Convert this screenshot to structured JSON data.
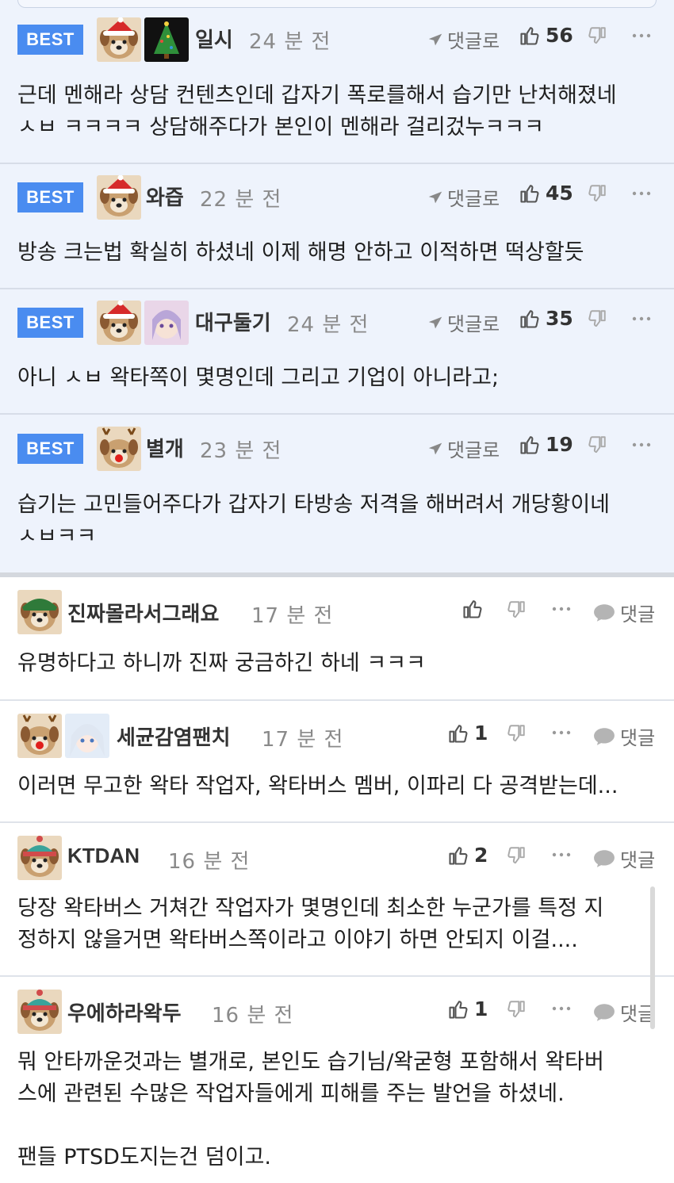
{
  "best_comments": [
    {
      "badge": "BEST",
      "nickname": "일시",
      "time": "24 분 전",
      "reply_label": "댓글로",
      "likes": "56",
      "text": "근데 멘해라 상담 컨텐츠인데 갑자기 폭로를해서 습기만 난처해졌네\nㅅㅂ ㅋㅋㅋㅋ 상담해주다가 본인이 멘해라 걸리겄누ㅋㅋㅋ"
    },
    {
      "badge": "BEST",
      "nickname": "와즙",
      "time": "22 분 전",
      "reply_label": "댓글로",
      "likes": "45",
      "text": "방송 크는법 확실히 하셨네 이제 해명 안하고 이적하면 떡상할듯"
    },
    {
      "badge": "BEST",
      "nickname": "대구둘기",
      "time": "24 분 전",
      "reply_label": "댓글로",
      "likes": "35",
      "text": "아니 ㅅㅂ 왁타쪽이 몇명인데 그리고 기업이 아니라고;"
    },
    {
      "badge": "BEST",
      "nickname": "별개",
      "time": "23 분 전",
      "reply_label": "댓글로",
      "likes": "19",
      "text": "습기는 고민들어주다가 갑자기 타방송 저격을 해버려서 개당황이네\nㅅㅂㅋㅋ"
    }
  ],
  "comments": [
    {
      "nickname": "진짜몰라서그래요",
      "time": "17 분 전",
      "likes": "",
      "reply_label": "댓글",
      "text": "유명하다고 하니까 진짜 궁금하긴 하네 ㅋㅋㅋ"
    },
    {
      "nickname": "세균감염팬치",
      "time": "17 분 전",
      "likes": "1",
      "reply_label": "댓글",
      "text": "이러면 무고한 왁타 작업자, 왁타버스 멤버, 이파리 다 공격받는데..."
    },
    {
      "nickname": "KTDAN",
      "time": "16 분 전",
      "likes": "2",
      "reply_label": "댓글",
      "text": "당장 왁타버스 거쳐간 작업자가 몇명인데 최소한 누군가를 특정 지\n정하지 않을거면 왁타버스쪽이라고 이야기 하면 안되지 이걸...."
    },
    {
      "nickname": "우에하라왁두",
      "time": "16 분 전",
      "likes": "1",
      "reply_label": "댓글",
      "text": "뭐 안타까운것과는 별개로, 본인도 습기님/왁굳형 포함해서 왁타버\n스에 관련된 수많은 작업자들에게 피해를 주는 발언을 하셨네.\n\n팬들 PTSD도지는건 덤이고."
    }
  ],
  "colors": {
    "best_bg": "#eef3fc",
    "badge": "#4a8cf0",
    "icon": "#6f6f6f"
  },
  "icons": [
    "reply-arrow-icon",
    "thumbs-up-icon",
    "thumbs-down-icon",
    "more-dots-icon",
    "speech-bubble-icon"
  ]
}
